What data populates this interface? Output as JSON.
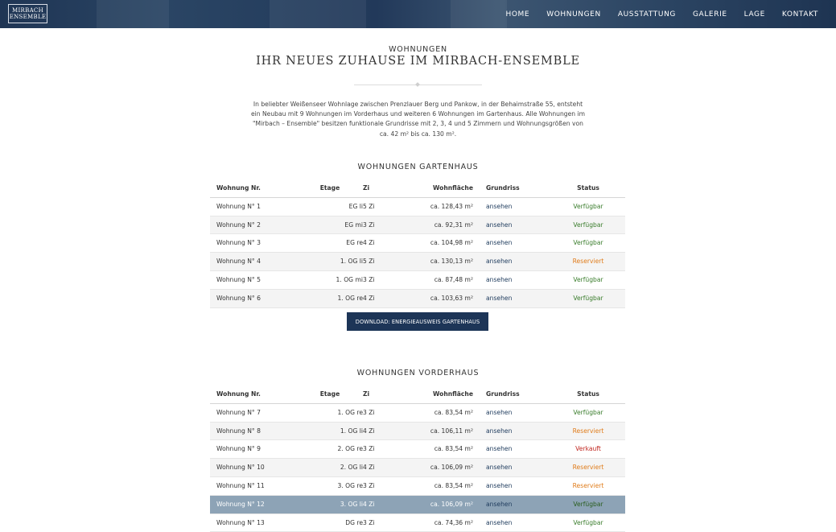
{
  "logo": {
    "line1": "MIRBACH",
    "line2": "ENSEMBLE"
  },
  "nav": {
    "items": [
      "HOME",
      "WOHNUNGEN",
      "AUSSTATTUNG",
      "GALERIE",
      "LAGE",
      "KONTAKT"
    ]
  },
  "intro": {
    "kicker": "WOHNUNGEN",
    "headline": "IHR NEUES ZUHAUSE IM MIRBACH-ENSEMBLE",
    "text": "In beliebter Weißenseer Wohnlage zwischen Prenzlauer Berg und Pankow, in der Behaimstraße 55, entsteht ein Neubau mit 9 Wohnungen im Vorderhaus und weiteren 6 Wohnungen im Gartenhaus. Alle Wohnungen im \"Mirbach – Ensemble\" besitzen funktionale Grundrisse mit 2, 3, 4 und 5 Zimmern und Wohnungsgrößen von ca. 42 m² bis ca. 130 m²."
  },
  "headers": {
    "nr": "Wohnung Nr.",
    "etage": "Etage",
    "zi": "Zi",
    "wf": "Wohnfläche",
    "grundriss": "Grundriss",
    "status": "Status"
  },
  "colors": {
    "verfuegbar": "#3a7d2c",
    "reserviert": "#e07c1a",
    "verkauft": "#c0261f",
    "button": "#1d3557",
    "selected_row": "#8da3b6"
  },
  "gartenhaus": {
    "title": "WOHNUNGEN GARTENHAUS",
    "rows": [
      {
        "nr": "Wohnung N° 1",
        "etage": "EG li",
        "zi": "5 Zi",
        "wf": "ca. 128,43 m²",
        "grundriss": "ansehen",
        "status": "Verfügbar"
      },
      {
        "nr": "Wohnung N° 2",
        "etage": "EG mi",
        "zi": "3 Zi",
        "wf": "ca. 92,31 m²",
        "grundriss": "ansehen",
        "status": "Verfügbar"
      },
      {
        "nr": "Wohnung N° 3",
        "etage": "EG re",
        "zi": "4 Zi",
        "wf": "ca. 104,98 m²",
        "grundriss": "ansehen",
        "status": "Verfügbar"
      },
      {
        "nr": "Wohnung N° 4",
        "etage": "1. OG li",
        "zi": "5 Zi",
        "wf": "ca. 130,13 m²",
        "grundriss": "ansehen",
        "status": "Reserviert"
      },
      {
        "nr": "Wohnung N° 5",
        "etage": "1. OG mi",
        "zi": "3 Zi",
        "wf": "ca. 87,48 m²",
        "grundriss": "ansehen",
        "status": "Verfügbar"
      },
      {
        "nr": "Wohnung N° 6",
        "etage": "1. OG re",
        "zi": "4 Zi",
        "wf": "ca. 103,63 m²",
        "grundriss": "ansehen",
        "status": "Verfügbar"
      }
    ],
    "download_label": "DOWNLOAD: ENERGIEAUSWEIS GARTENHAUS"
  },
  "vorderhaus": {
    "title": "WOHNUNGEN VORDERHAUS",
    "rows": [
      {
        "nr": "Wohnung N° 7",
        "etage": "1. OG re",
        "zi": "3 Zi",
        "wf": "ca. 83,54 m²",
        "grundriss": "ansehen",
        "status": "Verfügbar"
      },
      {
        "nr": "Wohnung N° 8",
        "etage": "1. OG li",
        "zi": "4 Zi",
        "wf": "ca. 106,11 m²",
        "grundriss": "ansehen",
        "status": "Reserviert"
      },
      {
        "nr": "Wohnung N° 9",
        "etage": "2. OG re",
        "zi": "3 Zi",
        "wf": "ca. 83,54 m²",
        "grundriss": "ansehen",
        "status": "Verkauft"
      },
      {
        "nr": "Wohnung N° 10",
        "etage": "2. OG li",
        "zi": "4 Zi",
        "wf": "ca. 106,09 m²",
        "grundriss": "ansehen",
        "status": "Reserviert"
      },
      {
        "nr": "Wohnung N° 11",
        "etage": "3. OG re",
        "zi": "3 Zi",
        "wf": "ca. 83,54 m²",
        "grundriss": "ansehen",
        "status": "Reserviert"
      },
      {
        "nr": "Wohnung N° 12",
        "etage": "3. OG li",
        "zi": "4 Zi",
        "wf": "ca. 106,09 m²",
        "grundriss": "ansehen",
        "status": "Verfügbar"
      },
      {
        "nr": "Wohnung N° 13",
        "etage": "DG re",
        "zi": "3 Zi",
        "wf": "ca. 74,36 m²",
        "grundriss": "ansehen",
        "status": "Verfügbar"
      }
    ]
  }
}
